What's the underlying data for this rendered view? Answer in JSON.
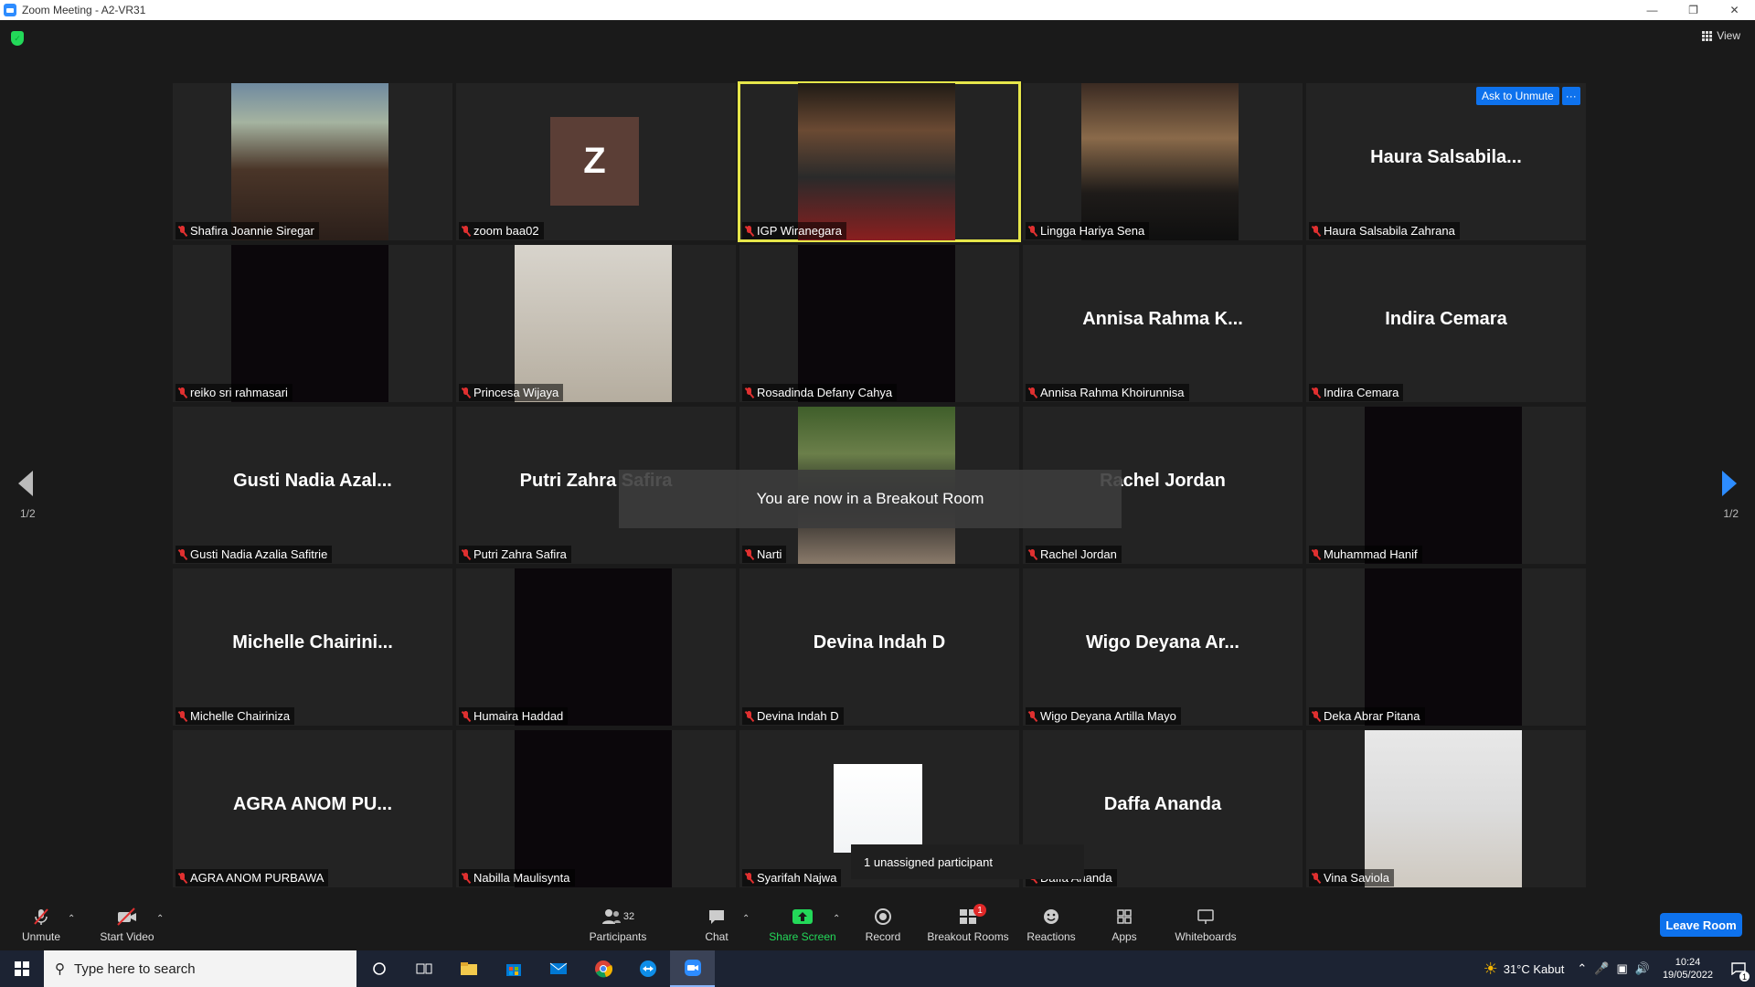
{
  "window": {
    "title": "Zoom Meeting - A2-VR31"
  },
  "header": {
    "view_label": "View"
  },
  "tiles": [
    {
      "name": "Shafira Joannie Siregar",
      "display": "",
      "type": "photo"
    },
    {
      "name": "zoom baa02",
      "display": "",
      "type": "avatar",
      "avatar_letter": "Z"
    },
    {
      "name": "IGP Wiranegara",
      "display": "",
      "type": "photo",
      "active": true
    },
    {
      "name": "Lingga Hariya Sena",
      "display": "",
      "type": "photo"
    },
    {
      "name": "Haura Salsabila Zahrana",
      "display": "Haura  Salsabila...",
      "type": "name"
    },
    {
      "name": "reiko sri rahmasari",
      "display": "",
      "type": "dark"
    },
    {
      "name": "Princesa Wijaya",
      "display": "",
      "type": "photo"
    },
    {
      "name": "Rosadinda Defany Cahya",
      "display": "",
      "type": "dark"
    },
    {
      "name": "Annisa Rahma Khoirunnisa",
      "display": "Annisa  Rahma  K...",
      "type": "name"
    },
    {
      "name": "Indira Cemara",
      "display": "Indira Cemara",
      "type": "name"
    },
    {
      "name": "Gusti Nadia Azalia Safitrie",
      "display": "Gusti  Nadia  Azal...",
      "type": "name"
    },
    {
      "name": "Putri Zahra Safira",
      "display": "Putri Zahra Safira",
      "type": "name"
    },
    {
      "name": "Narti",
      "display": "",
      "type": "photo"
    },
    {
      "name": "Rachel Jordan",
      "display": "Rachel Jordan",
      "type": "name"
    },
    {
      "name": "Muhammad Hanif",
      "display": "",
      "type": "dark"
    },
    {
      "name": "Michelle Chairiniza",
      "display": "Michelle  Chairini...",
      "type": "name"
    },
    {
      "name": "Humaira Haddad",
      "display": "",
      "type": "dark"
    },
    {
      "name": "Devina Indah D",
      "display": "Devina Indah D",
      "type": "name"
    },
    {
      "name": "Wigo Deyana Artilla Mayo",
      "display": "Wigo  Deyana  Ar...",
      "type": "name"
    },
    {
      "name": "Deka Abrar Pitana",
      "display": "",
      "type": "dark"
    },
    {
      "name": "AGRA ANOM PURBAWA",
      "display": "AGRA  ANOM  PU...",
      "type": "name"
    },
    {
      "name": "Nabilla Maulisynta",
      "display": "",
      "type": "dark"
    },
    {
      "name": "Syarifah Najwa",
      "display": "",
      "type": "photo"
    },
    {
      "name": "Daffa Ananda",
      "display": "Daffa Ananda",
      "type": "name"
    },
    {
      "name": "Vina Saviola",
      "display": "",
      "type": "photo"
    }
  ],
  "ask_to_unmute": {
    "label": "Ask to Unmute",
    "more": "···"
  },
  "pager": {
    "left": "1/2",
    "right": "1/2"
  },
  "toast": {
    "message": "You are now in a Breakout Room"
  },
  "unassigned": {
    "text": "1 unassigned participant"
  },
  "toolbar": {
    "unmute": "Unmute",
    "start_video": "Start Video",
    "participants": "Participants",
    "participants_count": "32",
    "chat": "Chat",
    "share_screen": "Share Screen",
    "record": "Record",
    "breakout_rooms": "Breakout Rooms",
    "breakout_badge": "1",
    "reactions": "Reactions",
    "apps": "Apps",
    "whiteboards": "Whiteboards",
    "leave_room": "Leave Room"
  },
  "taskbar": {
    "search_placeholder": "Type here to search",
    "weather": "31°C  Kabut",
    "time": "10:24",
    "date": "19/05/2022",
    "notification_count": "1"
  },
  "colors": {
    "accent": "#0e72ed",
    "active_border": "#e6e64a",
    "muted": "#e03030",
    "share_green": "#23d959"
  }
}
